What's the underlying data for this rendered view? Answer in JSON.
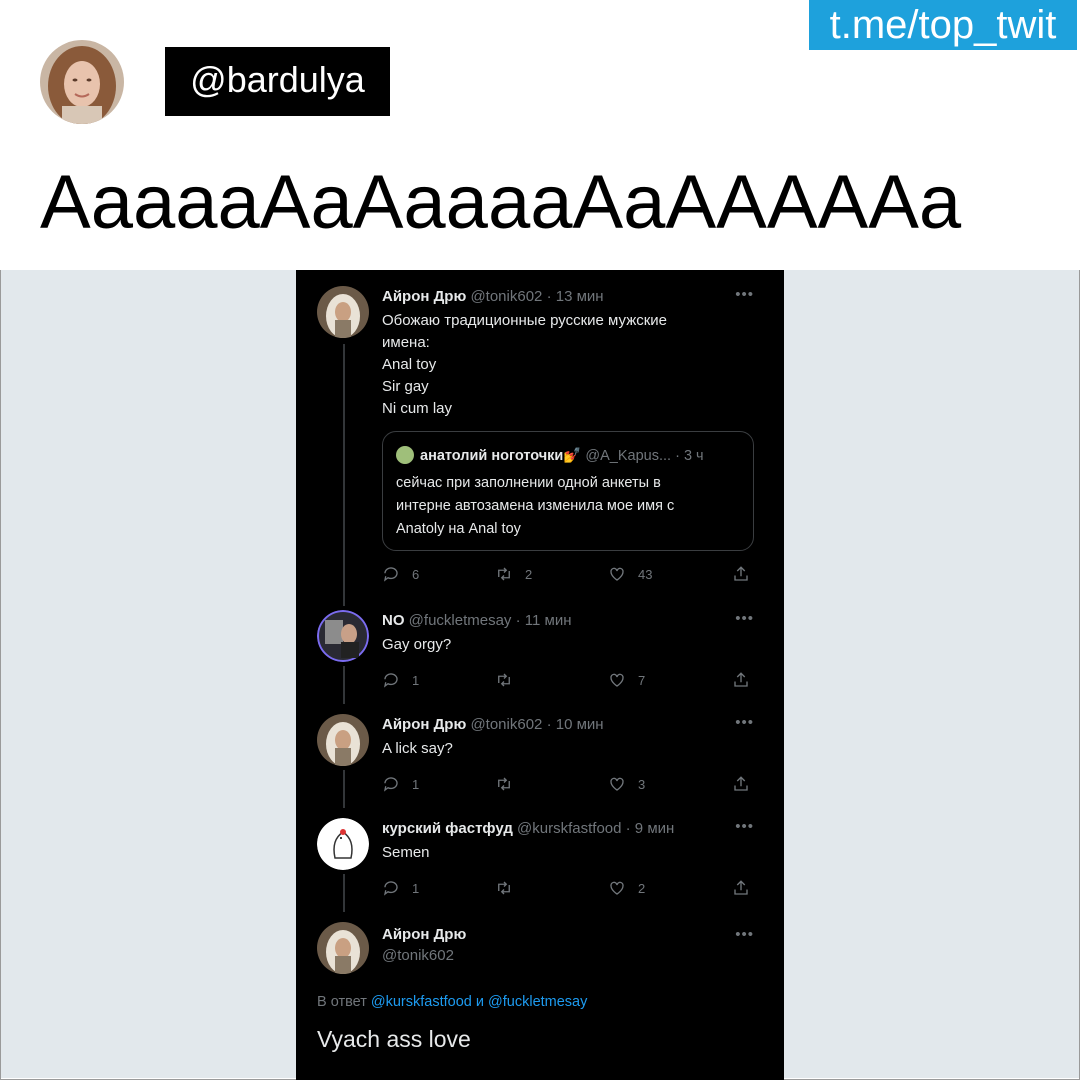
{
  "watermark": "t.me/top_twit",
  "poster": {
    "handle": "@bardulya"
  },
  "headline": "AaaaaAaAaaaaAaAAAAAa",
  "thread": {
    "tweets": [
      {
        "name": "Айрон Дрю",
        "handle": "@tonik602",
        "time": "· 13 мин",
        "lines": [
          "Обожаю традиционные русские мужские",
          "имена:",
          "Anal toy",
          "Sir gay",
          "Ni cum lay"
        ],
        "quote": {
          "name": "анатолий ноготочки💅",
          "handle": "@A_Kapus...",
          "time": "· 3 ч",
          "lines": [
            "сейчас при заполнении одной анкеты в",
            "интерне автозамена изменила мое имя с",
            "Anatoly на Anal toy"
          ]
        },
        "replies": "6",
        "retweets": "2",
        "likes": "43"
      },
      {
        "name": "NO",
        "handle": "@fuckletmesay",
        "time": "· 11 мин",
        "lines": [
          "Gay orgy?"
        ],
        "replies": "1",
        "retweets": "",
        "likes": "7"
      },
      {
        "name": "Айрон Дрю",
        "handle": "@tonik602",
        "time": "· 10 мин",
        "lines": [
          "A lick say?"
        ],
        "replies": "1",
        "retweets": "",
        "likes": "3"
      },
      {
        "name": "курский фастфуд",
        "handle": "@kurskfastfood",
        "time": "· 9 мин",
        "lines": [
          "Semen"
        ],
        "replies": "1",
        "retweets": "",
        "likes": "2"
      }
    ],
    "main": {
      "name": "Айрон Дрю",
      "handle": "@tonik602",
      "reply_prefix": "В ответ ",
      "reply_user1": "@kurskfastfood",
      "reply_and": " и ",
      "reply_user2": "@fuckletmesay",
      "text": "Vyach ass love"
    },
    "more_icon": "•••"
  },
  "colors": {
    "watermark_bg": "#1ea1dc",
    "accent_link": "#1d9bf0",
    "screenshot_bg": "#000000",
    "page_bg": "#e2e8ec"
  }
}
